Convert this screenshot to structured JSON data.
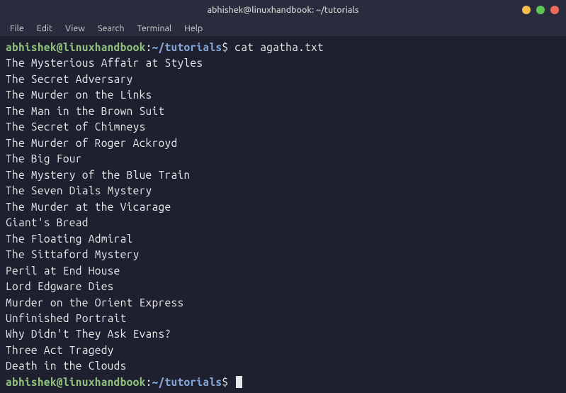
{
  "window": {
    "title": "abhishek@linuxhandbook: ~/tutorials"
  },
  "menubar": {
    "items": [
      "File",
      "Edit",
      "View",
      "Search",
      "Terminal",
      "Help"
    ]
  },
  "prompt": {
    "user_host": "abhishek@linuxhandbook",
    "separator": ":",
    "path": "~/tutorials",
    "symbol": "$"
  },
  "command1": "cat agatha.txt",
  "output": [
    "The Mysterious Affair at Styles",
    "The Secret Adversary",
    "The Murder on the Links",
    "The Man in the Brown Suit",
    "The Secret of Chimneys",
    "The Murder of Roger Ackroyd",
    "The Big Four",
    "The Mystery of the Blue Train",
    "The Seven Dials Mystery",
    "The Murder at the Vicarage",
    "Giant's Bread",
    "The Floating Admiral",
    "The Sittaford Mystery",
    "Peril at End House",
    "Lord Edgware Dies",
    "Murder on the Orient Express",
    "Unfinished Portrait",
    "Why Didn't They Ask Evans?",
    "Three Act Tragedy",
    "Death in the Clouds"
  ],
  "command2": ""
}
